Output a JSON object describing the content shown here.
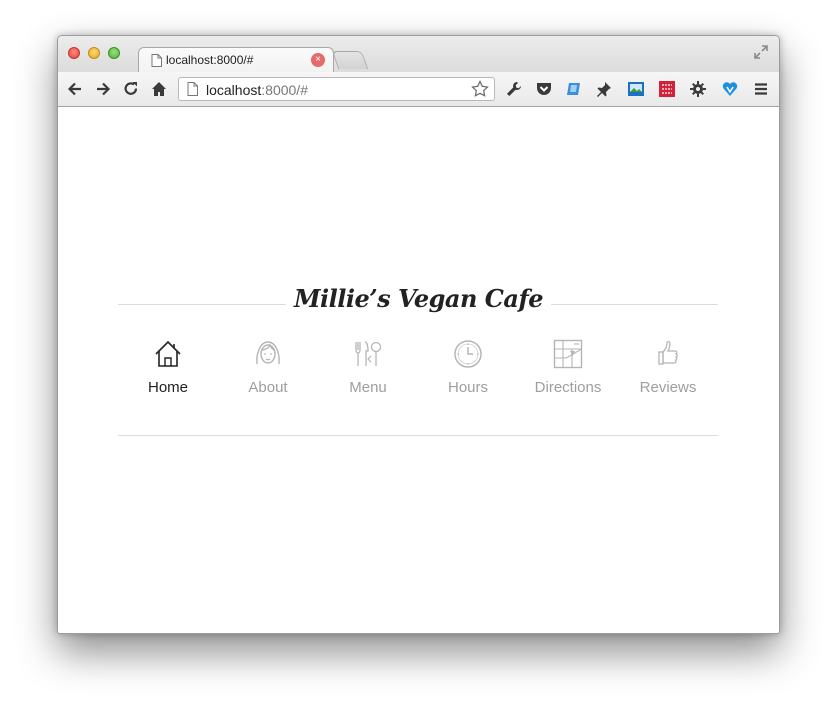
{
  "browser": {
    "tab_title": "localhost:8000/#",
    "tab_close": "×",
    "url_host": "localhost",
    "url_rest": ":8000/#"
  },
  "site": {
    "title": "Millie’s Vegan Cafe",
    "nav": [
      {
        "label": "Home",
        "icon": "house-icon",
        "active": true
      },
      {
        "label": "About",
        "icon": "woman-face-icon",
        "active": false
      },
      {
        "label": "Menu",
        "icon": "utensils-icon",
        "active": false
      },
      {
        "label": "Hours",
        "icon": "clock-icon",
        "active": false
      },
      {
        "label": "Directions",
        "icon": "map-icon",
        "active": false
      },
      {
        "label": "Reviews",
        "icon": "thumbs-up-icon",
        "active": false
      }
    ]
  },
  "colors": {
    "active": "#222222",
    "inactive": "#9e9e9e",
    "rule": "#dcdcdc"
  }
}
